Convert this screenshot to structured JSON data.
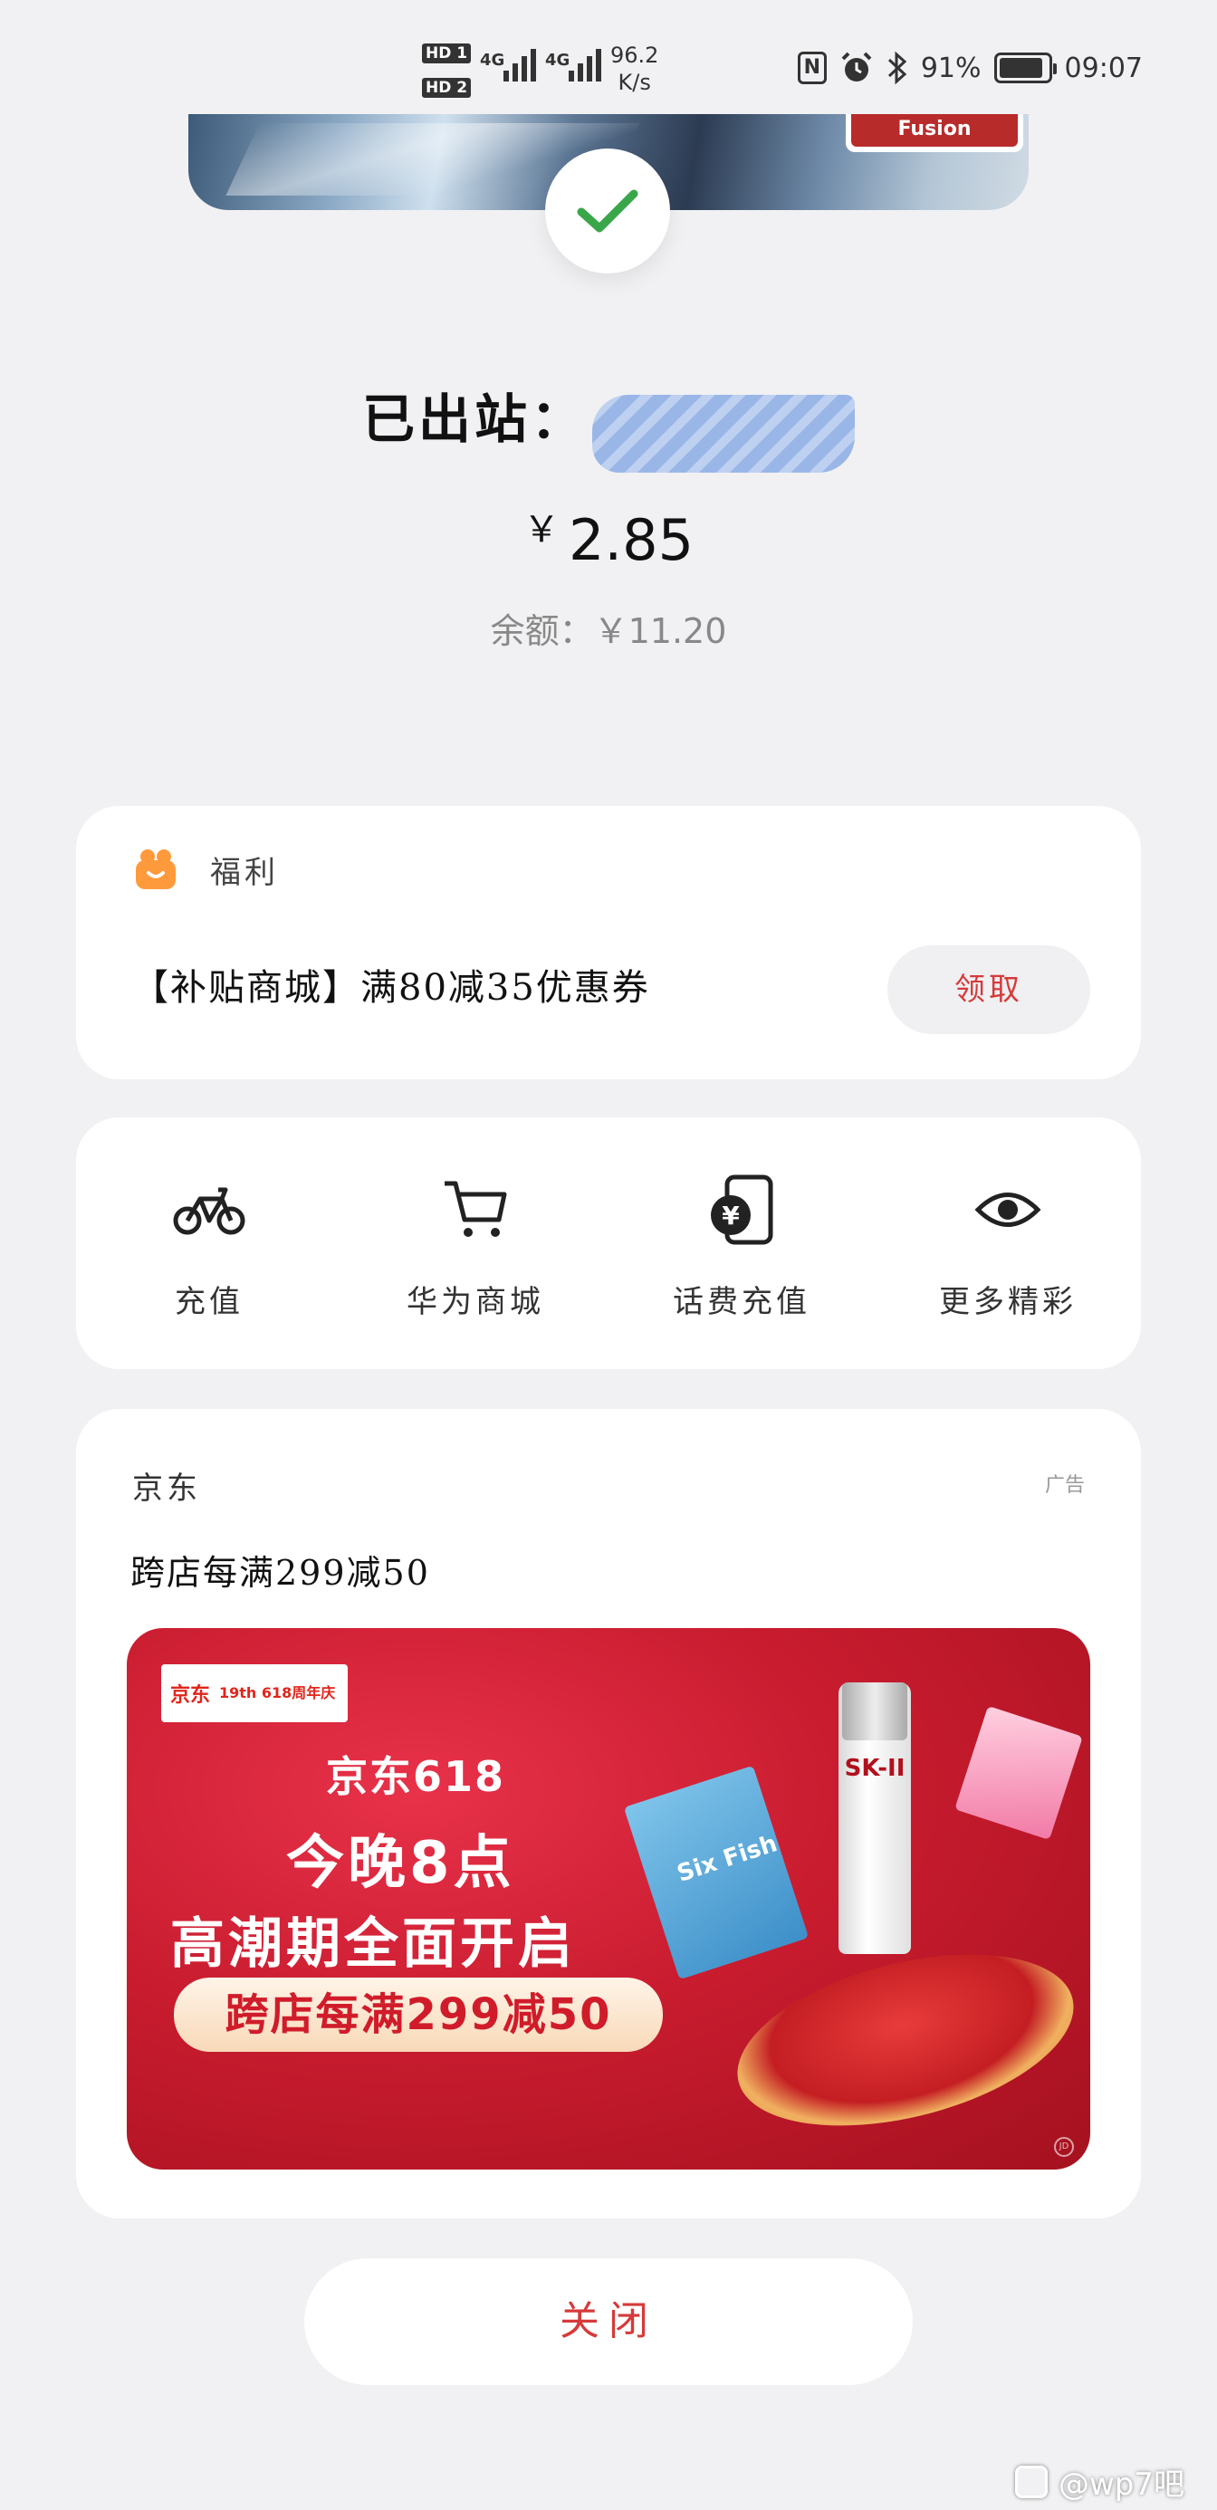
{
  "status_bar": {
    "hd1": "HD 1",
    "hd2": "HD 2",
    "net1": "4G",
    "net2": "4G",
    "speed_value": "96.2",
    "speed_unit": "K/s",
    "nfc": "N",
    "battery_percent": "91%",
    "battery_level": 0.91,
    "time": "09:07"
  },
  "card": {
    "brand_label": "Fusion"
  },
  "trip": {
    "exit_label": "已出站：",
    "currency": "￥",
    "fare": "2.85",
    "balance": "余额：￥11.20"
  },
  "welfare": {
    "title": "福利",
    "coupon": "【补贴商城】满80减35优惠券",
    "claim_label": "领取"
  },
  "services": {
    "items": [
      {
        "label": "充值",
        "icon": "bicycle-icon"
      },
      {
        "label": "华为商城",
        "icon": "cart-icon"
      },
      {
        "label": "话费充值",
        "icon": "phone-yuan-icon"
      },
      {
        "label": "更多精彩",
        "icon": "eye-icon"
      }
    ]
  },
  "ad": {
    "brand": "京东",
    "tag": "广告",
    "desc": "跨店每满299减50",
    "banner": {
      "logo_jd": "京东",
      "logo_anniv": "19th 618周年庆",
      "line1": "京东618",
      "line2": "今晚8点",
      "line3": "高潮期全面开启",
      "promo": "跨店每满299减50",
      "bottle_label": "SK-II",
      "box_label": "Six Fish",
      "corner_mark": "JD"
    }
  },
  "close_label": "关闭",
  "watermark": "@wp7吧",
  "colors": {
    "background": "#f1f1f3",
    "accent_red": "#d63a3a",
    "check_green": "#3aa64a"
  }
}
